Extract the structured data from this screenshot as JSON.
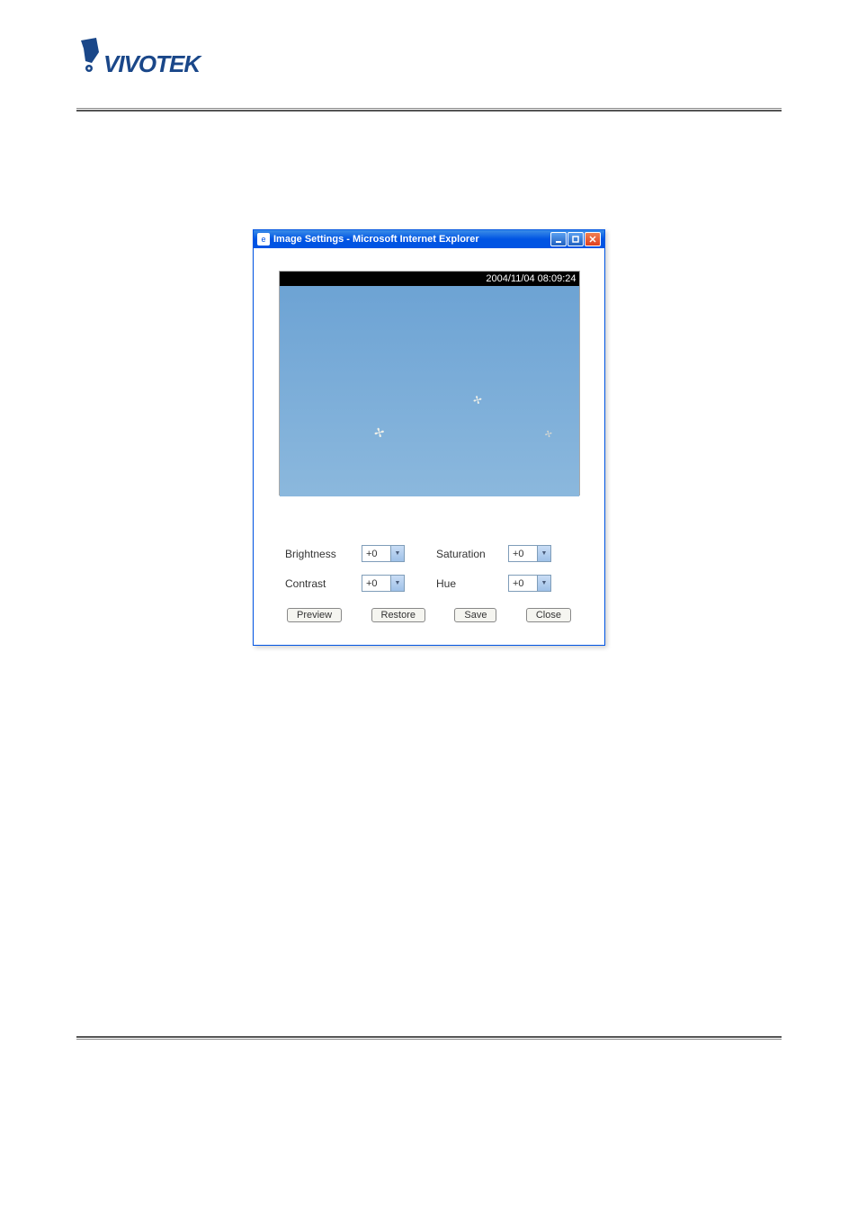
{
  "logo": {
    "brand": "VIVOTEK"
  },
  "window": {
    "title": "Image Settings - Microsoft Internet Explorer",
    "titlebar_buttons": {
      "minimize": "_",
      "maximize": "□",
      "close": "×"
    }
  },
  "video": {
    "timestamp": "2004/11/04 08:09:24"
  },
  "controls": {
    "brightness_label": "Brightness",
    "brightness_value": "+0",
    "contrast_label": "Contrast",
    "contrast_value": "+0",
    "saturation_label": "Saturation",
    "saturation_value": "+0",
    "hue_label": "Hue",
    "hue_value": "+0"
  },
  "buttons": {
    "preview": "Preview",
    "restore": "Restore",
    "save": "Save",
    "close": "Close"
  }
}
